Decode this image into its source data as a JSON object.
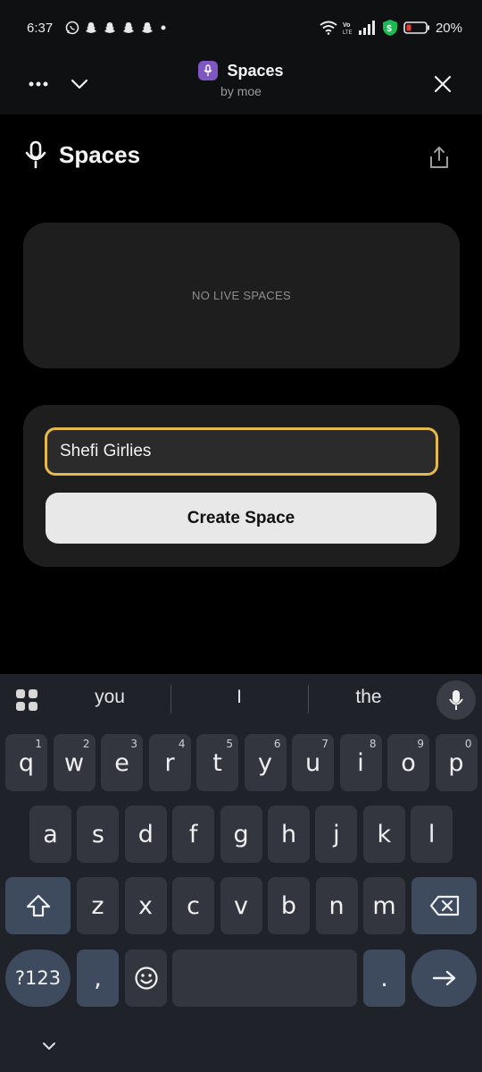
{
  "status_bar": {
    "time": "6:37",
    "battery_percent": "20%",
    "left_icons": [
      "whatsapp-icon",
      "snapchat-icon",
      "snapchat-icon",
      "snapchat-icon",
      "snapchat-icon",
      "dot-icon"
    ],
    "right_icons": [
      "wifi-icon",
      "volte-icon",
      "signal-icon",
      "shield-dollar-icon",
      "battery-icon"
    ],
    "shield_color": "#1db954",
    "battery_level_color": "#e53935"
  },
  "header": {
    "title": "Spaces",
    "subtitle": "by moe",
    "app_icon_color": "#7e57c2",
    "menu_icon": "more-horizontal-icon",
    "dropdown_icon": "chevron-down-icon",
    "close_icon": "close-icon"
  },
  "page": {
    "title": "Spaces",
    "title_icon": "microphone-icon",
    "share_icon": "share-icon",
    "live_empty_text": "NO LIVE SPACES",
    "space_name_value": "Shefi Girlies",
    "input_border_color": "#e6b94c",
    "create_button_label": "Create Space"
  },
  "keyboard": {
    "suggestions": [
      "you",
      "I",
      "the"
    ],
    "row1": [
      {
        "k": "q",
        "h": "1"
      },
      {
        "k": "w",
        "h": "2"
      },
      {
        "k": "e",
        "h": "3"
      },
      {
        "k": "r",
        "h": "4"
      },
      {
        "k": "t",
        "h": "5"
      },
      {
        "k": "y",
        "h": "6"
      },
      {
        "k": "u",
        "h": "7"
      },
      {
        "k": "i",
        "h": "8"
      },
      {
        "k": "o",
        "h": "9"
      },
      {
        "k": "p",
        "h": "0"
      }
    ],
    "row2": [
      "a",
      "s",
      "d",
      "f",
      "g",
      "h",
      "j",
      "k",
      "l"
    ],
    "row3": [
      "z",
      "x",
      "c",
      "v",
      "b",
      "n",
      "m"
    ],
    "symbols_label": "?123",
    "comma_label": ",",
    "period_label": "."
  }
}
